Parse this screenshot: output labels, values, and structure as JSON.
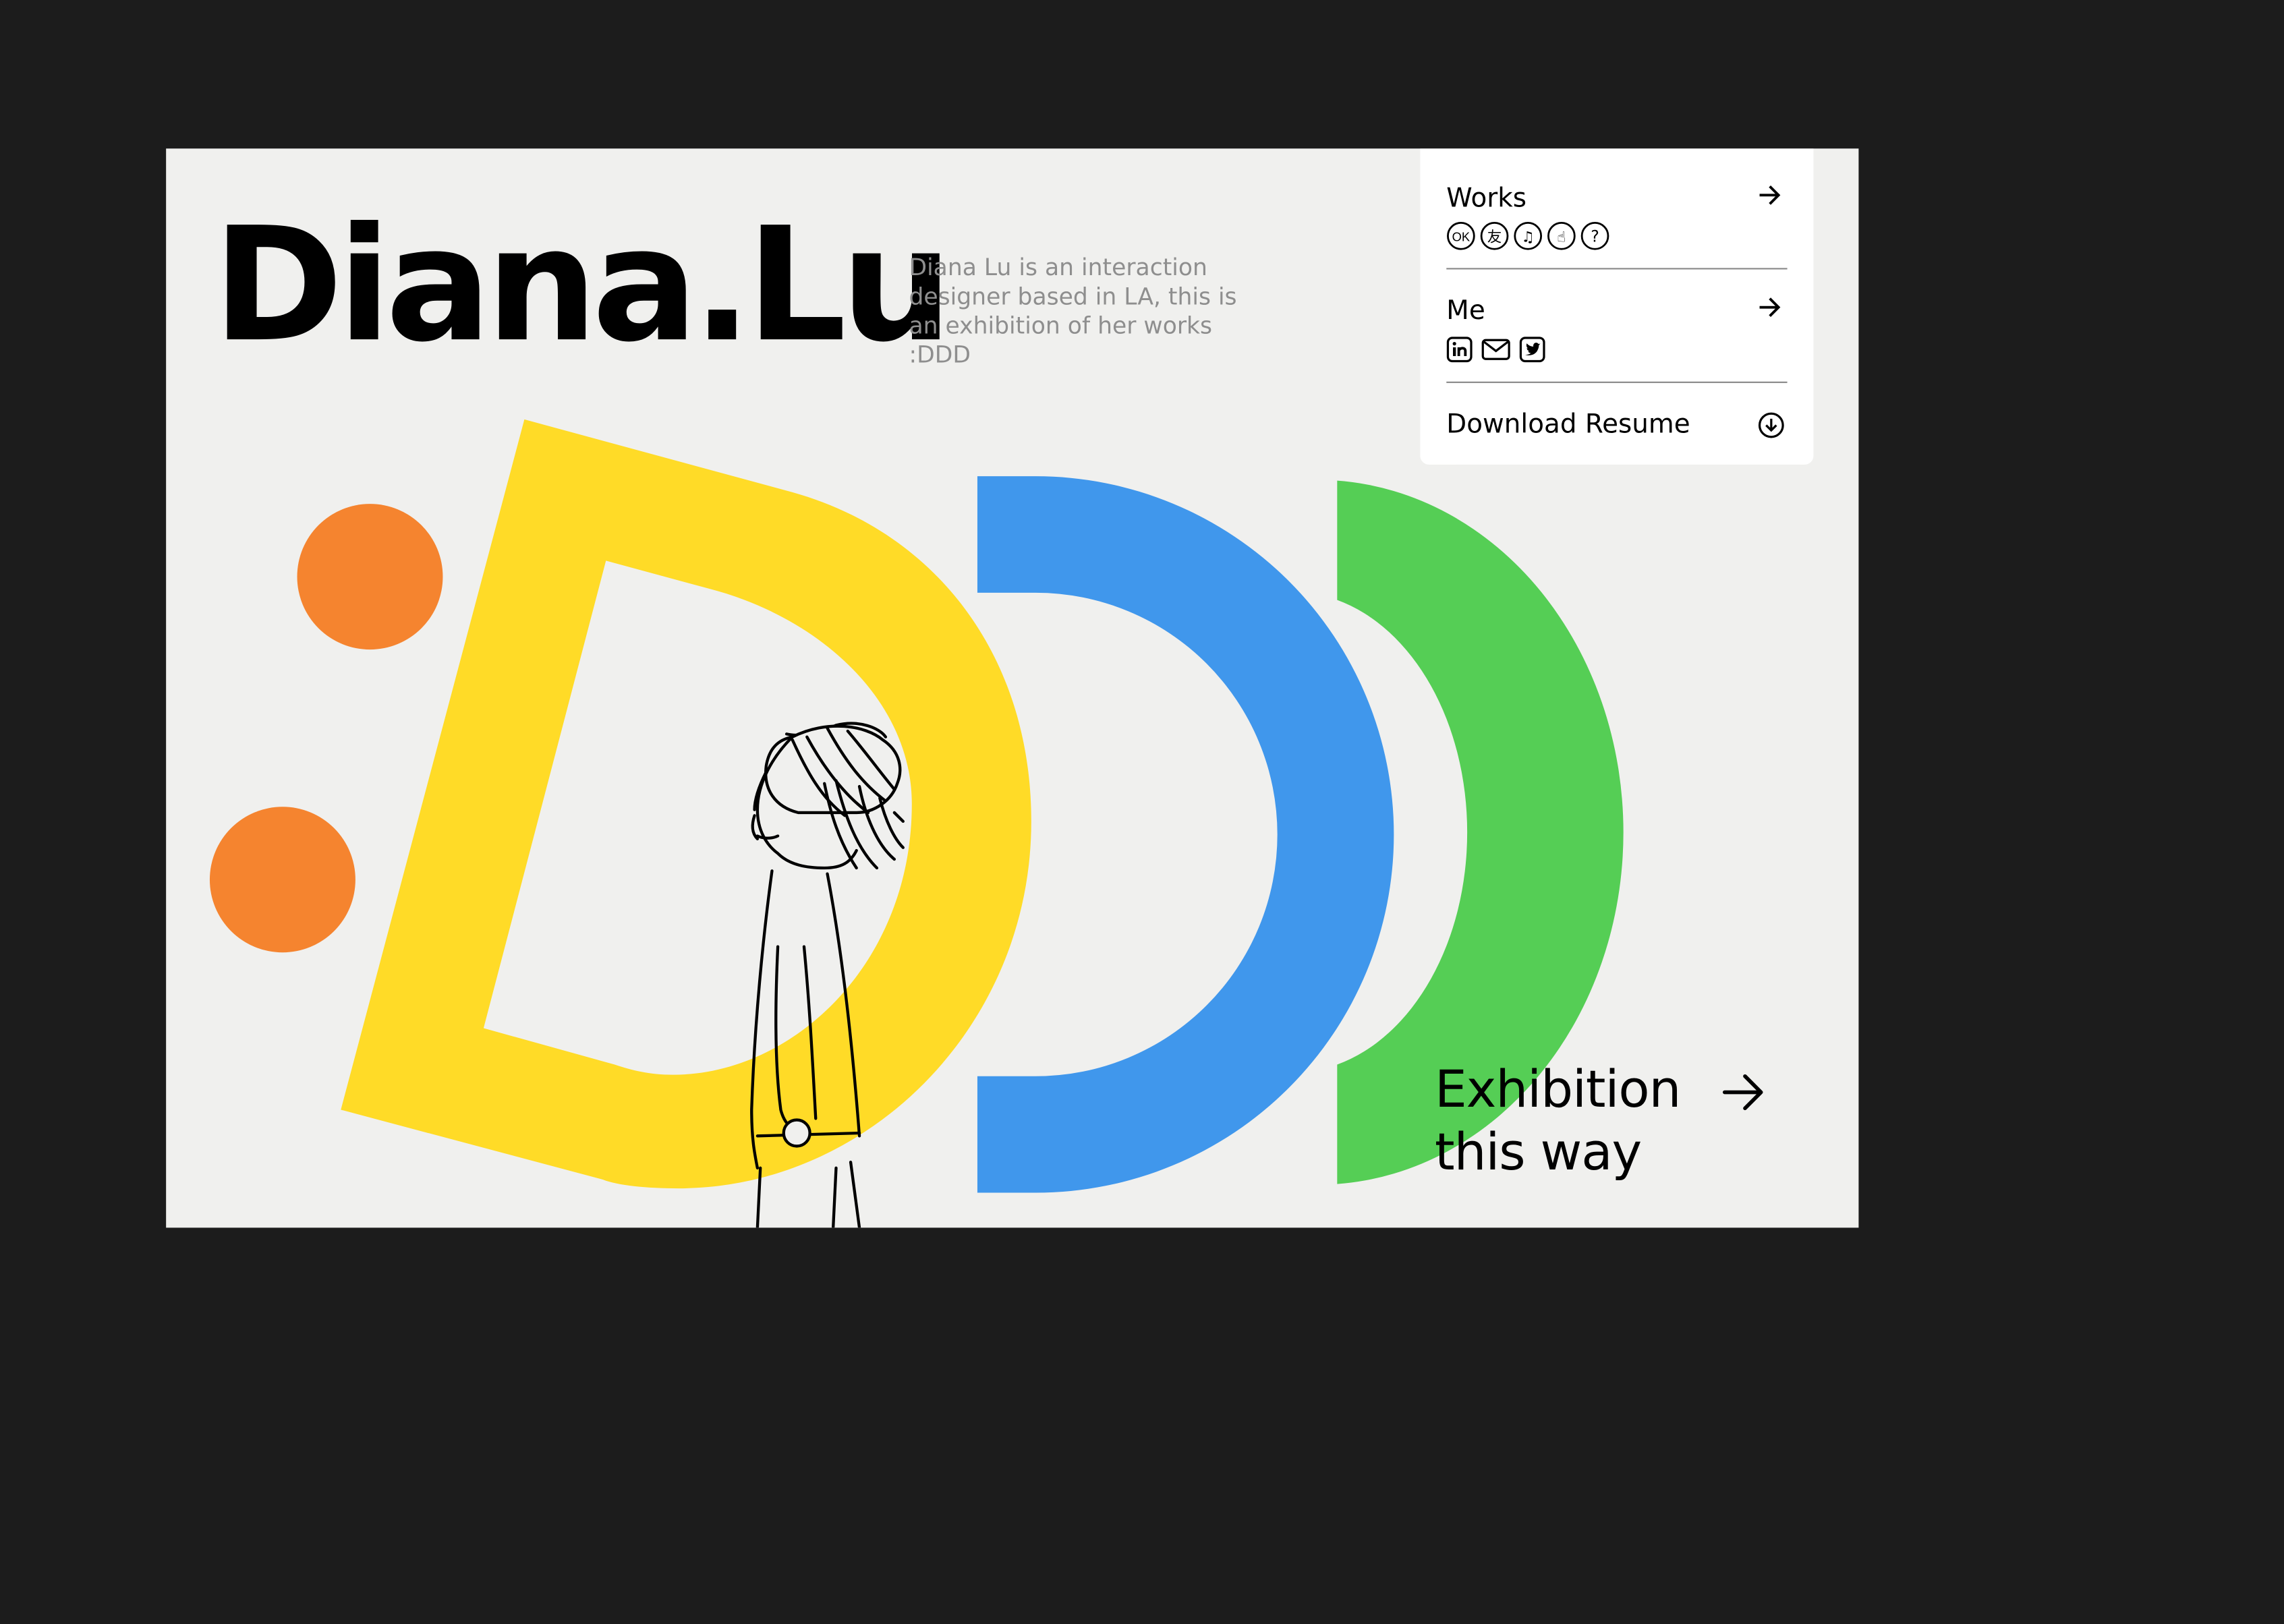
{
  "brand": {
    "name": "Diana.Lu"
  },
  "intro": {
    "text": "Diana Lu is an interaction designer based in LA, this is an exhibition of her works :DDD"
  },
  "menu": {
    "works": {
      "label": "Works",
      "icons": [
        {
          "icon": "ok-icon",
          "glyph": "OK"
        },
        {
          "icon": "friend-character-icon",
          "glyph": "友"
        },
        {
          "icon": "music-note-icon",
          "glyph": "♫"
        },
        {
          "icon": "hand-pointer-icon",
          "glyph": "☝"
        },
        {
          "icon": "question-icon",
          "glyph": "?"
        }
      ]
    },
    "me": {
      "label": "Me",
      "icons": [
        "linkedin-icon",
        "mail-icon",
        "twitter-icon"
      ]
    },
    "resume": {
      "label": "Download Resume",
      "icon": "download-circle-icon"
    }
  },
  "cta": {
    "line1": "Exhibition",
    "line2": "this way",
    "icon": "arrow-right-icon"
  },
  "colors": {
    "background": "#1c1c1c",
    "page": "#f0f0ee",
    "yellow": "#ffdb27",
    "blue": "#4097ec",
    "green": "#55ce55",
    "orange": "#f5842f"
  }
}
